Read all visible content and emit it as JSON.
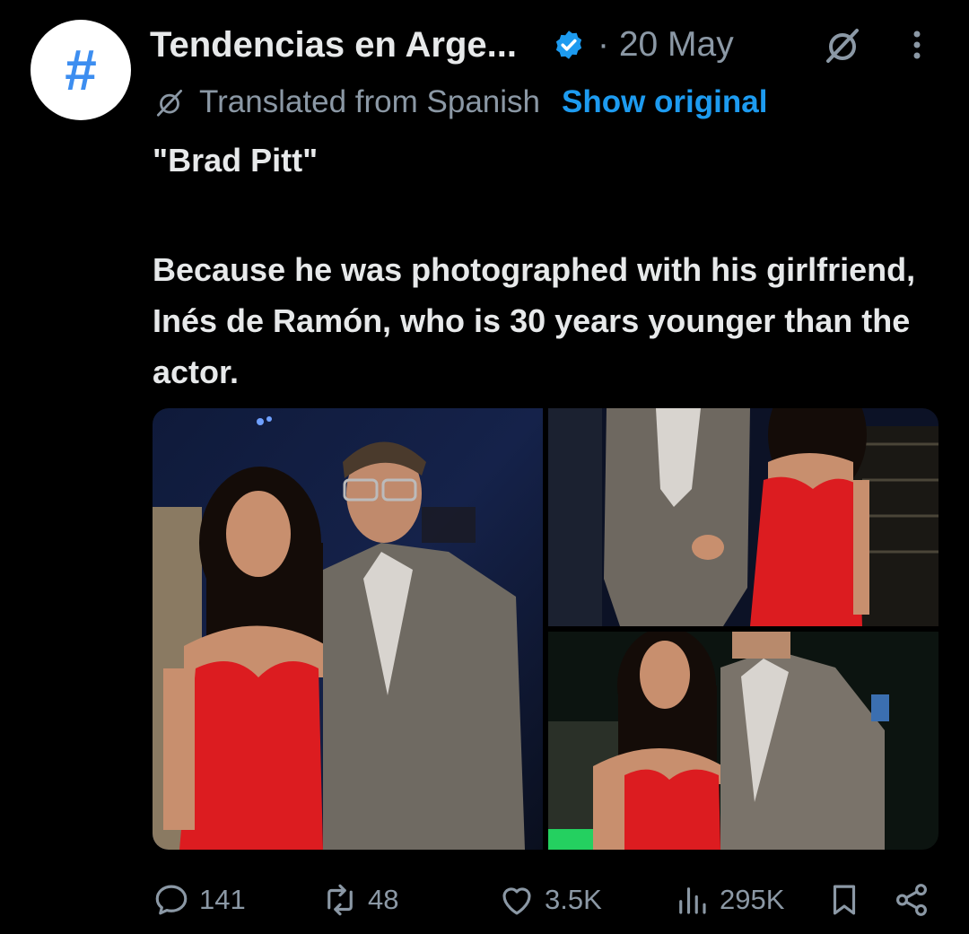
{
  "post": {
    "avatar_symbol": "#",
    "author_name": "Tendencias en Arge...",
    "verified_icon": "verified-badge-icon",
    "date": "· 20 May",
    "translation": {
      "label": "Translated from Spanish",
      "show_original": "Show original"
    },
    "title": "\"Brad Pitt\"",
    "text": "Because he was photographed with his girlfriend, Inés de Ramón, who is 30 years younger than the actor.",
    "media": [
      {
        "icon": "photo",
        "description_hidden": true
      },
      {
        "icon": "photo",
        "description_hidden": true
      },
      {
        "icon": "photo",
        "description_hidden": true
      }
    ]
  },
  "actions": {
    "replies": "141",
    "reposts": "48",
    "likes": "3.5K",
    "views": "295K"
  },
  "colors": {
    "background": "#000000",
    "text": "#e7e9ea",
    "muted": "#8b98a5",
    "link": "#1d9bf0",
    "avatar_glyph": "#3d8ef0"
  }
}
